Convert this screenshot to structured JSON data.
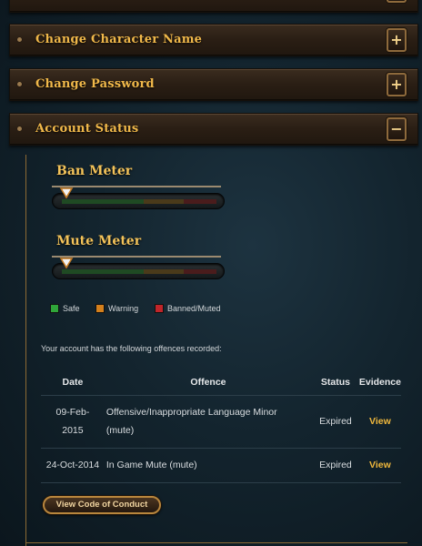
{
  "accordion": {
    "character_name": {
      "title": "Change Character Name",
      "toggle": "+"
    },
    "password": {
      "title": "Change Password",
      "toggle": "+"
    },
    "account_status": {
      "title": "Account Status",
      "toggle": "−"
    }
  },
  "meters": {
    "ban": {
      "label": "Ban Meter",
      "level": 0
    },
    "mute": {
      "label": "Mute Meter",
      "level": 0
    }
  },
  "legend": [
    {
      "label": "Safe",
      "color": "#2fa63a"
    },
    {
      "label": "Warning",
      "color": "#d4801c"
    },
    {
      "label": "Banned/Muted",
      "color": "#c0252a"
    }
  ],
  "offences": {
    "intro": "Your account has the following offences recorded:",
    "columns": {
      "date": "Date",
      "offence": "Offence",
      "status": "Status",
      "evidence": "Evidence"
    },
    "rows": [
      {
        "date_line1": "09-Feb-",
        "date_line2": "2015",
        "offence_line1": "Offensive/Inappropriate Language Minor",
        "offence_line2": "(mute)",
        "status": "Expired",
        "evidence": "View"
      },
      {
        "date_line1": "24-Oct-2014",
        "offence_line1": "In Game Mute (mute)",
        "status": "Expired",
        "evidence": "View"
      }
    ]
  },
  "code_of_conduct_button": "View Code of Conduct"
}
